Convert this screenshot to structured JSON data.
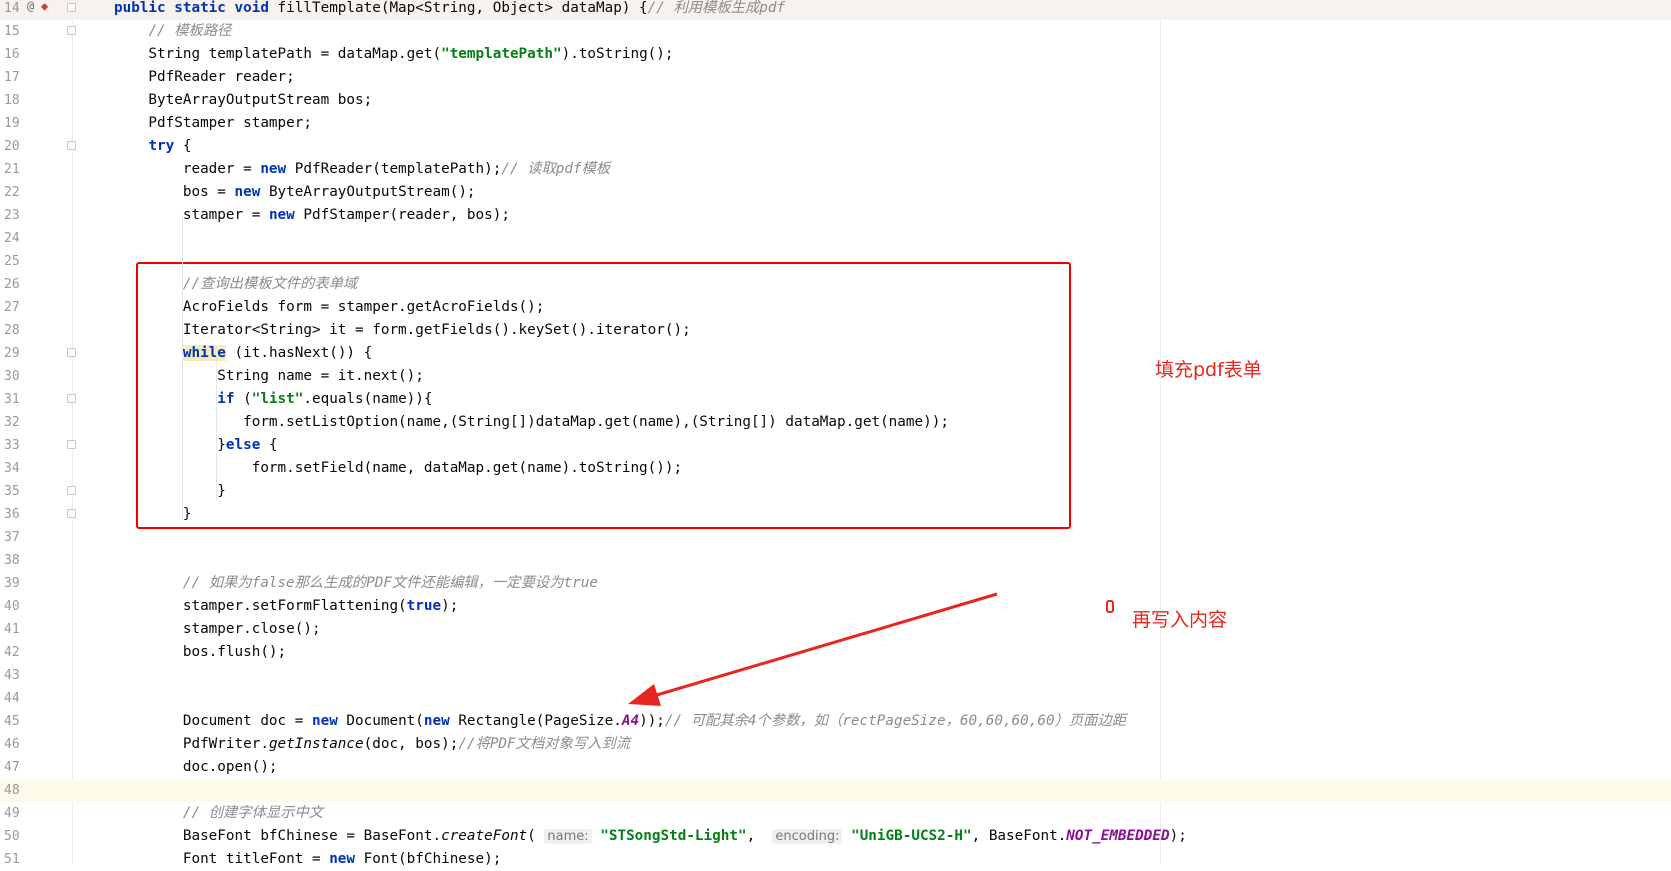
{
  "annotations": {
    "fill_form": "填充pdf表单",
    "write_content": "再写入内容"
  },
  "colors": {
    "keyword": "#0033b3",
    "string": "#067d17",
    "comment": "#8c8c8c",
    "annotation_red": "#e8261f",
    "current_line": "#fcfae9"
  },
  "gutter_icons": [
    "at-sign-icon",
    "breakpoint-icon"
  ],
  "lines": [
    {
      "n": "14",
      "t": [
        [
          "kw",
          "public static void "
        ],
        [
          "p",
          "fillTemplate(Map<String, Object> dataMap) {"
        ],
        [
          "cmt",
          "// 利用模板生成pdf"
        ]
      ]
    },
    {
      "n": "15",
      "t": [
        [
          "p",
          "    "
        ],
        [
          "cmt",
          "// 模板路径"
        ]
      ]
    },
    {
      "n": "16",
      "t": [
        [
          "p",
          "    String templatePath = dataMap.get("
        ],
        [
          "str",
          "\"templatePath\""
        ],
        [
          "p",
          ").toString();"
        ]
      ]
    },
    {
      "n": "17",
      "t": [
        [
          "p",
          "    PdfReader reader;"
        ]
      ]
    },
    {
      "n": "18",
      "t": [
        [
          "p",
          "    ByteArrayOutputStream bos;"
        ]
      ]
    },
    {
      "n": "19",
      "t": [
        [
          "p",
          "    PdfStamper stamper;"
        ]
      ]
    },
    {
      "n": "20",
      "t": [
        [
          "p",
          "    "
        ],
        [
          "kw",
          "try"
        ],
        [
          "p",
          " {"
        ]
      ]
    },
    {
      "n": "21",
      "t": [
        [
          "p",
          "        reader = "
        ],
        [
          "kw",
          "new"
        ],
        [
          "p",
          " PdfReader(templatePath);"
        ],
        [
          "cmt",
          "// 读取pdf模板"
        ]
      ]
    },
    {
      "n": "22",
      "t": [
        [
          "p",
          "        bos = "
        ],
        [
          "kw",
          "new"
        ],
        [
          "p",
          " ByteArrayOutputStream();"
        ]
      ]
    },
    {
      "n": "23",
      "t": [
        [
          "p",
          "        stamper = "
        ],
        [
          "kw",
          "new"
        ],
        [
          "p",
          " PdfStamper(reader, bos);"
        ]
      ]
    },
    {
      "n": "24",
      "t": []
    },
    {
      "n": "25",
      "t": []
    },
    {
      "n": "26",
      "t": [
        [
          "p",
          "        "
        ],
        [
          "cmt",
          "//查询出模板文件的表单域"
        ]
      ]
    },
    {
      "n": "27",
      "t": [
        [
          "p",
          "        AcroFields form = stamper.getAcroFields();"
        ]
      ]
    },
    {
      "n": "28",
      "t": [
        [
          "p",
          "        Iterator<String> it = form.getFields().keySet().iterator();"
        ]
      ]
    },
    {
      "n": "29",
      "t": [
        [
          "p",
          "        "
        ],
        [
          "kwhl",
          "while"
        ],
        [
          "p",
          " (it.hasNext()) {"
        ]
      ]
    },
    {
      "n": "30",
      "t": [
        [
          "p",
          "            String name = it.next();"
        ]
      ]
    },
    {
      "n": "31",
      "t": [
        [
          "p",
          "            "
        ],
        [
          "kw",
          "if"
        ],
        [
          "p",
          " ("
        ],
        [
          "str",
          "\"list\""
        ],
        [
          "p",
          ".equals(name)){"
        ]
      ]
    },
    {
      "n": "32",
      "t": [
        [
          "p",
          "               form.setListOption(name,(String[])dataMap.get(name),(String[]) dataMap.get(name));"
        ]
      ]
    },
    {
      "n": "33",
      "t": [
        [
          "p",
          "            }"
        ],
        [
          "kw",
          "else"
        ],
        [
          "p",
          " {"
        ]
      ]
    },
    {
      "n": "34",
      "t": [
        [
          "p",
          "                form.setField(name, dataMap.get(name).toString());"
        ]
      ]
    },
    {
      "n": "35",
      "t": [
        [
          "p",
          "            }"
        ]
      ]
    },
    {
      "n": "36",
      "t": [
        [
          "p",
          "        }"
        ]
      ]
    },
    {
      "n": "37",
      "t": []
    },
    {
      "n": "38",
      "t": []
    },
    {
      "n": "39",
      "t": [
        [
          "p",
          "        "
        ],
        [
          "cmt",
          "// 如果为false那么生成的PDF文件还能编辑，一定要设为true"
        ]
      ]
    },
    {
      "n": "40",
      "t": [
        [
          "p",
          "        stamper.setFormFlattening("
        ],
        [
          "kw",
          "true"
        ],
        [
          "p",
          ");"
        ]
      ]
    },
    {
      "n": "41",
      "t": [
        [
          "p",
          "        stamper.close();"
        ]
      ]
    },
    {
      "n": "42",
      "t": [
        [
          "p",
          "        bos.flush();"
        ]
      ]
    },
    {
      "n": "43",
      "t": []
    },
    {
      "n": "44",
      "t": []
    },
    {
      "n": "45",
      "t": [
        [
          "p",
          "        Document doc = "
        ],
        [
          "kw",
          "new"
        ],
        [
          "p",
          " Document("
        ],
        [
          "kw",
          "new"
        ],
        [
          "p",
          " Rectangle(PageSize."
        ],
        [
          "const",
          "A4"
        ],
        [
          "p",
          "));"
        ],
        [
          "cmt",
          "// 可配其余4个参数，如（rectPageSize，60,60,60,60）页面边距"
        ]
      ]
    },
    {
      "n": "46",
      "t": [
        [
          "p",
          "        PdfWriter."
        ],
        [
          "it",
          "getInstance"
        ],
        [
          "p",
          "(doc, bos);"
        ],
        [
          "cmt",
          "//将PDF文档对象写入到流"
        ]
      ]
    },
    {
      "n": "47",
      "t": [
        [
          "p",
          "        doc.open();"
        ]
      ]
    },
    {
      "n": "48",
      "t": []
    },
    {
      "n": "49",
      "t": [
        [
          "p",
          "        "
        ],
        [
          "cmt",
          "// 创建字体显示中文"
        ]
      ]
    },
    {
      "n": "50",
      "t": [
        [
          "p",
          "        BaseFont bfChinese = BaseFont."
        ],
        [
          "it",
          "createFont"
        ],
        [
          "p",
          "( "
        ],
        [
          "hint",
          "name:"
        ],
        [
          "p",
          " "
        ],
        [
          "str",
          "\"STSongStd-Light\""
        ],
        [
          "p",
          ",  "
        ],
        [
          "hint",
          "encoding:"
        ],
        [
          "p",
          " "
        ],
        [
          "str",
          "\"UniGB-UCS2-H\""
        ],
        [
          "p",
          ", BaseFont."
        ],
        [
          "const",
          "NOT_EMBEDDED"
        ],
        [
          "p",
          ");"
        ]
      ]
    },
    {
      "n": "51",
      "t": [
        [
          "p",
          "        Font titleFont = "
        ],
        [
          "kw",
          "new"
        ],
        [
          "p",
          " Font(bfChinese);"
        ]
      ]
    }
  ]
}
